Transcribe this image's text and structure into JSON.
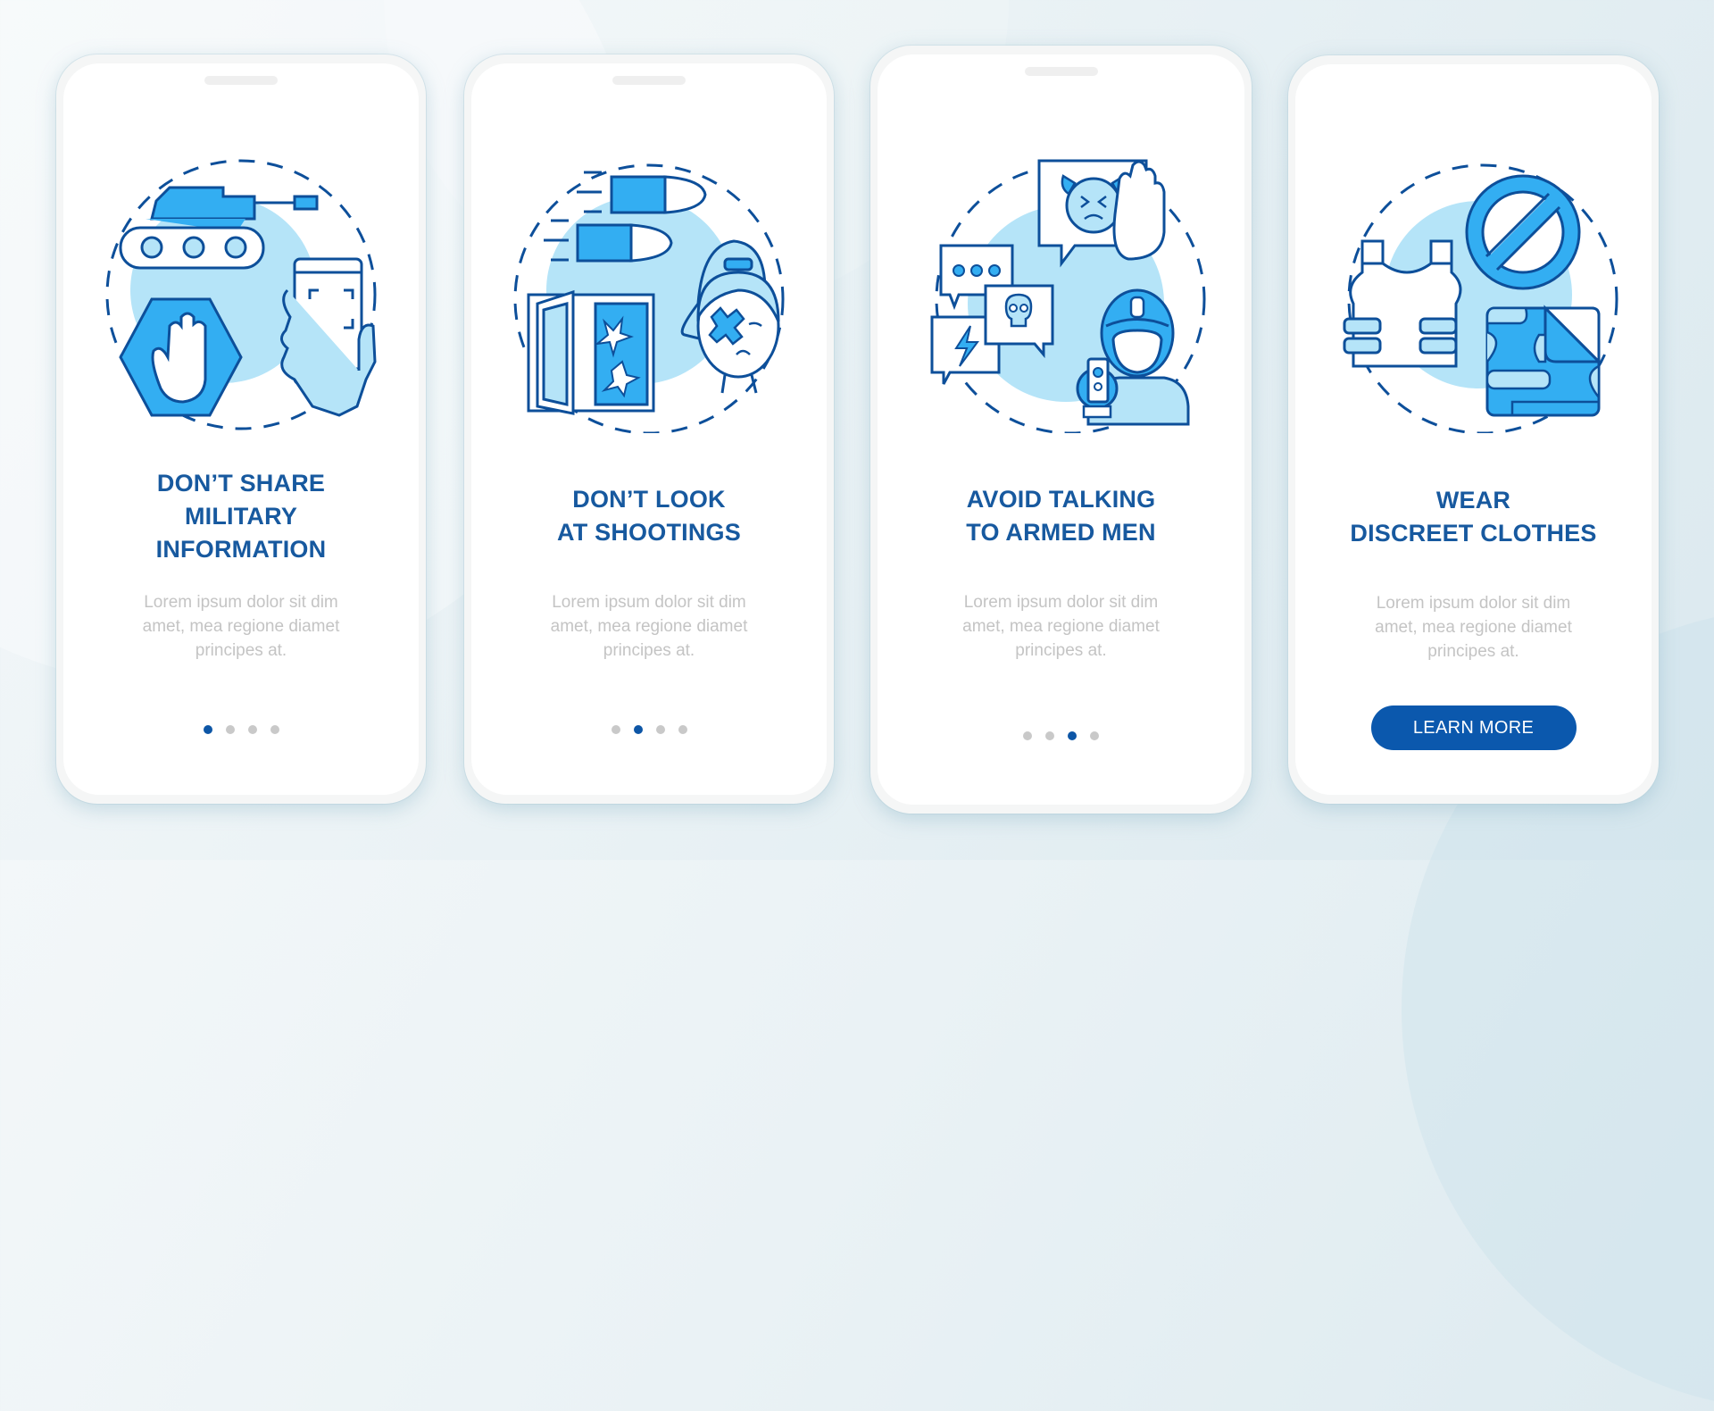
{
  "colors": {
    "title": "#17599f",
    "body_text": "#c4c4c4",
    "dot_active": "#0d56a6",
    "dot_inactive": "#c9c9c9",
    "button_bg": "#0b58ad",
    "icon_stroke": "#0d4f9a",
    "icon_fill": "#33aef2",
    "icon_light": "#b5e4f8"
  },
  "screens": [
    {
      "illustration": "stop-hand-tank-phone-icon",
      "title_lines": [
        "DON’T SHARE",
        "MILITARY",
        "INFORMATION"
      ],
      "body_lines": [
        "Lorem ipsum dolor sit dim",
        "amet, mea regione diamet",
        "principes at."
      ],
      "page_indicator": {
        "total": 4,
        "active": 1
      }
    },
    {
      "illustration": "bullets-window-injured-girl-icon",
      "title_lines": [
        "DON’T LOOK",
        "AT SHOOTINGS"
      ],
      "body_lines": [
        "Lorem ipsum dolor sit dim",
        "amet, mea regione diamet",
        "principes at."
      ],
      "page_indicator": {
        "total": 4,
        "active": 2
      }
    },
    {
      "illustration": "speech-bubbles-armed-soldier-icon",
      "title_lines": [
        "AVOID TALKING",
        "TO ARMED MEN"
      ],
      "body_lines": [
        "Lorem ipsum dolor sit dim",
        "amet, mea regione diamet",
        "principes at."
      ],
      "page_indicator": {
        "total": 4,
        "active": 3
      }
    },
    {
      "illustration": "vest-prohibited-camouflage-icon",
      "title_lines": [
        "WEAR",
        "DISCREET CLOTHES"
      ],
      "body_lines": [
        "Lorem ipsum dolor sit dim",
        "amet, mea regione diamet",
        "principes at."
      ],
      "button_label": "LEARN MORE"
    }
  ]
}
